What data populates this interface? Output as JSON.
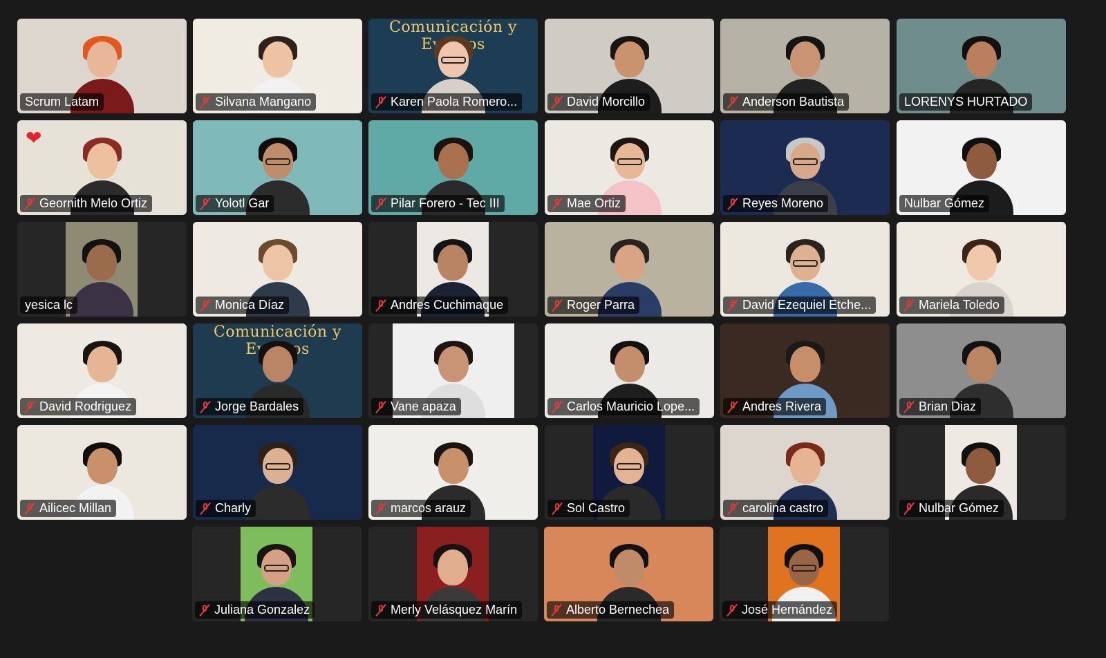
{
  "meeting": {
    "participants": [
      {
        "name": "Scrum Latam",
        "muted": false,
        "active_speaker": true,
        "bg": "#dcd6cf",
        "skin": "#e8b79a",
        "hair": "#e2561f",
        "shirt": "#7a1a1a"
      },
      {
        "name": "Silvana Mangano",
        "muted": true,
        "bg": "#f0ece4",
        "skin": "#eec3a3",
        "hair": "#2e211b",
        "shirt": "#f2f2f2"
      },
      {
        "name": "Karen Paola Romero...",
        "muted": true,
        "bg": "#1d3d55",
        "banner": "Comunicación y Eventos",
        "skin": "#efc6ad",
        "hair": "#5a3a22",
        "shirt": "#d8d0c8",
        "glasses": true
      },
      {
        "name": "David Morcillo",
        "muted": true,
        "bg": "#cfccc6",
        "skin": "#c9936d",
        "hair": "#1b1410",
        "shirt": "#1d1d1d"
      },
      {
        "name": "Anderson Bautista",
        "muted": true,
        "bg": "#b7b2a6",
        "skin": "#c89474",
        "hair": "#141414",
        "shirt": "#222222"
      },
      {
        "name": "LORENYS HURTADO",
        "muted": false,
        "bg": "#6f8d8c",
        "skin": "#b97f5e",
        "hair": "#151010",
        "shirt": "#252525"
      },
      {
        "name": "Geornith Melo Ortiz",
        "muted": true,
        "reaction": "❤",
        "bg": "#e7e2d8",
        "skin": "#edc0a0",
        "hair": "#8a2b24",
        "shirt": "#2b2b2b"
      },
      {
        "name": "Yolotl Gar",
        "muted": true,
        "bg": "#7fb9b9",
        "skin": "#c08d6b",
        "hair": "#120d0d",
        "shirt": "#2c2c2c",
        "glasses": true
      },
      {
        "name": "Pilar Forero - Tec III",
        "muted": true,
        "bg": "#5fa9a6",
        "skin": "#a9714f",
        "hair": "#1a1410",
        "shirt": "#2a2a2a"
      },
      {
        "name": "Mae Ortiz",
        "muted": true,
        "bg": "#ece8e2",
        "skin": "#e8b797",
        "hair": "#1d1612",
        "shirt": "#f4c3c8",
        "glasses": true
      },
      {
        "name": "Reyes Moreno",
        "muted": true,
        "bg": "#1b2b52",
        "skin": "#d8a88a",
        "hair": "#c7c7c7",
        "shirt": "#3a3f4a",
        "glasses": true
      },
      {
        "name": "Nulbar Gómez",
        "muted": false,
        "bg": "#f2f2f2",
        "skin": "#8e5b3e",
        "hair": "#101010",
        "shirt": "#1c1c1c"
      },
      {
        "name": "yesica lc",
        "muted": false,
        "bg": "#8f8a73",
        "inset": "narrow",
        "skin": "#9b6b4d",
        "hair": "#141111",
        "shirt": "#3b3246"
      },
      {
        "name": "Monica Díaz",
        "muted": true,
        "bg": "#eeeae3",
        "skin": "#eec4a6",
        "hair": "#6b4a2e",
        "shirt": "#2f3a4a"
      },
      {
        "name": "Andres Cuchimaque",
        "muted": true,
        "bg": "#ece9e4",
        "inset": "narrow",
        "skin": "#b98463",
        "hair": "#141414",
        "shirt": "#1b2233"
      },
      {
        "name": "Roger Parra",
        "muted": true,
        "bg": "#b9b29f",
        "skin": "#d9a385",
        "hair": "#2a2220",
        "shirt": "#2b3c66"
      },
      {
        "name": "David Ezequiel Etche...",
        "muted": true,
        "bg": "#ece8e0",
        "skin": "#dfb091",
        "hair": "#2a2420",
        "shirt": "#3a6aa8",
        "glasses": true
      },
      {
        "name": "Mariela Toledo",
        "muted": true,
        "bg": "#eeeae2",
        "skin": "#f0c9ad",
        "hair": "#3a2418",
        "shirt": "#d8d4cd"
      },
      {
        "name": "David Rodriguez",
        "muted": true,
        "bg": "#eeeae3",
        "skin": "#e6b596",
        "hair": "#1a1410",
        "shirt": "#f3f3f3"
      },
      {
        "name": "Jorge Bardales",
        "muted": true,
        "bg": "#1e3b50",
        "banner": "Comunicación y Eventos",
        "skin": "#b98564",
        "hair": "#141010",
        "shirt": "#2a2a2a"
      },
      {
        "name": "Vane apaza",
        "muted": true,
        "bg": "#efefef",
        "inset": "wide",
        "skin": "#c89475",
        "hair": "#1e1512",
        "shirt": "#dedede"
      },
      {
        "name": "Carlos Mauricio Lope...",
        "muted": true,
        "bg": "#eceae6",
        "skin": "#c48e6d",
        "hair": "#141010",
        "shirt": "#1e1e1e"
      },
      {
        "name": "Andres Rivera",
        "muted": true,
        "bg": "#3b2a22",
        "skin": "#c88e69",
        "hair": "#1a1a1a",
        "shirt": "#6f9ac6"
      },
      {
        "name": "Brian Diaz",
        "muted": true,
        "bg": "#8e8e8e",
        "skin": "#b98563",
        "hair": "#121010",
        "shirt": "#2e2e2e"
      },
      {
        "name": "Ailicec Millan",
        "muted": true,
        "bg": "#ece7df",
        "skin": "#c8916c",
        "hair": "#120e0c",
        "shirt": "#f2f2f2"
      },
      {
        "name": "Charly",
        "muted": true,
        "bg": "#172a4c",
        "skin": "#dcb093",
        "hair": "#2c2017",
        "shirt": "#2c2c2c",
        "glasses": true
      },
      {
        "name": "marcos arauz",
        "muted": true,
        "bg": "#f0eeea",
        "skin": "#c8916c",
        "hair": "#1b1512",
        "shirt": "#2b2b2b"
      },
      {
        "name": "Sol Castro",
        "muted": true,
        "bg": "#0f1a3d",
        "inset": "narrow",
        "skin": "#e4b393",
        "hair": "#3b2618",
        "shirt": "#2a2a2a",
        "glasses": true
      },
      {
        "name": "carolina castro",
        "muted": true,
        "bg": "#dcd6cf",
        "skin": "#e6b495",
        "hair": "#7a2a1a",
        "shirt": "#1f2f54"
      },
      {
        "name": "Nulbar Gómez",
        "muted": true,
        "bg": "#eeeae3",
        "inset": "narrow",
        "skin": "#8e5b3e",
        "hair": "#101010",
        "shirt": "#2a2a2a"
      },
      {
        "name": "Juliana Gonzalez",
        "muted": true,
        "bg": "#7dbd5b",
        "inset": "narrow",
        "skin": "#d4a184",
        "hair": "#1b1410",
        "shirt": "#2d3142",
        "glasses": true
      },
      {
        "name": "Merly Velásquez Marín",
        "muted": true,
        "bg": "#8a1f1f",
        "inset": "narrow",
        "skin": "#e0ae8f",
        "hair": "#1a1212",
        "shirt": "#3a3a3a"
      },
      {
        "name": "Alberto Bernechea",
        "muted": true,
        "bg": "#d7875a",
        "skin": "#c08b69",
        "hair": "#161010",
        "shirt": "#2a2a2a"
      },
      {
        "name": "José Hernández",
        "muted": true,
        "bg": "#e0731f",
        "inset": "narrow",
        "skin": "#9a6446",
        "hair": "#121010",
        "shirt": "#f0f0f0",
        "glasses": true
      }
    ]
  }
}
